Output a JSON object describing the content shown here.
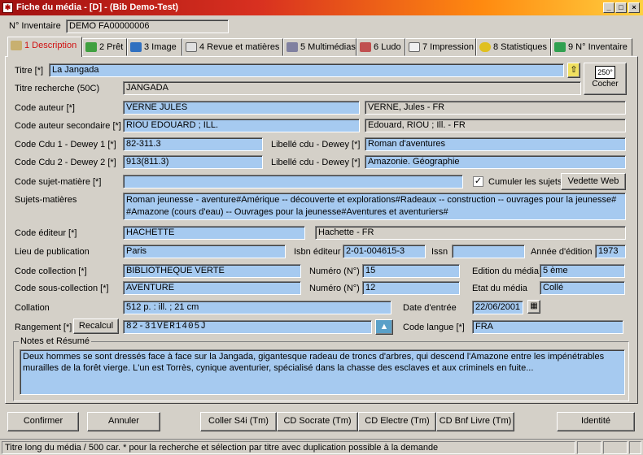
{
  "window": {
    "title": "Fiche du média - [D] - (Bib Demo-Test)"
  },
  "inventory": {
    "label": "N° Inventaire",
    "value": "DEMO FA00000006"
  },
  "tabs": [
    {
      "label": "1 Description"
    },
    {
      "label": "2 Prêt"
    },
    {
      "label": "3 Image"
    },
    {
      "label": "4 Revue et matières"
    },
    {
      "label": "5 Multimédias"
    },
    {
      "label": "6 Ludo"
    },
    {
      "label": "7 Impression"
    },
    {
      "label": "8 Statistiques"
    },
    {
      "label": "9 N° Inventaire"
    }
  ],
  "fields": {
    "titre": {
      "label": "Titre [*]",
      "value": "La Jangada"
    },
    "titre_recherche": {
      "label": "Titre recherche (50C)",
      "value": "JANGADA"
    },
    "code_auteur": {
      "label": "Code auteur [*]",
      "value": "VERNE JULES",
      "libelle": "VERNE, Jules - FR"
    },
    "code_auteur_sec": {
      "label": "Code auteur secondaire [*]",
      "value": "RIOU EDOUARD ; ILL.",
      "libelle": "Edouard, RIOU ; Ill. - FR"
    },
    "cdu1": {
      "label": "Code Cdu 1 - Dewey 1 [*]",
      "value": "82-311.3",
      "lib_label": "Libellé cdu - Dewey [*]",
      "libelle": "Roman d'aventures"
    },
    "cdu2": {
      "label": "Code Cdu 2 - Dewey 2 [*]",
      "value": "913(811.3)",
      "lib_label": "Libellé cdu - Dewey [*]",
      "libelle": "Amazonie. Géographie"
    },
    "sujet_matiere": {
      "label": "Code sujet-matière [*]",
      "value": "",
      "cumuler": "Cumuler les sujets",
      "vedette": "Vedette Web"
    },
    "sujets": {
      "label": "Sujets-matières",
      "value": "Roman jeunesse - aventure#Amérique -- découverte et explorations#Radeaux -- construction -- ouvrages pour la jeunesse# #Amazone (cours d'eau) -- Ouvrages pour la jeunesse#Aventures et aventuriers#"
    },
    "editeur": {
      "label": "Code éditeur [*]",
      "value": "HACHETTE",
      "libelle": "Hachette - FR"
    },
    "lieu": {
      "label": "Lieu de publication",
      "value": "Paris"
    },
    "isbn": {
      "label": "Isbn éditeur",
      "value": "2-01-004615-3"
    },
    "issn": {
      "label": "Issn",
      "value": ""
    },
    "annee": {
      "label": "Année d'édition",
      "value": "1973"
    },
    "collection": {
      "label": "Code collection [*]",
      "value": "BIBLIOTHEQUE VERTE"
    },
    "numero1": {
      "label": "Numéro (N°)",
      "value": "15"
    },
    "edition": {
      "label": "Edition du média",
      "value": "5 ème"
    },
    "sous_collection": {
      "label": "Code sous-collection [*]",
      "value": "AVENTURE"
    },
    "numero2": {
      "label": "Numéro (N°)",
      "value": "12"
    },
    "etat": {
      "label": "Etat du média",
      "value": "Collé"
    },
    "collation": {
      "label": "Collation",
      "value": "512 p. : ill. ; 21 cm"
    },
    "date_entree": {
      "label": "Date d'entrée",
      "value": "22/06/2001"
    },
    "rangement": {
      "label": "Rangement [*]",
      "value": "82-31VER1405J",
      "recalcul": "Recalcul"
    },
    "langue": {
      "label": "Code langue [*]",
      "value": "FRA"
    }
  },
  "notes": {
    "label": "Notes et Résumé",
    "value": "Deux hommes se sont dressés face à face sur la Jangada, gigantesque radeau de troncs d'arbres, qui descend l'Amazone entre les impénétrables murailles de la forêt vierge. L'un est Torrès, cynique aventurier, spécialisé dans la chasse des esclaves et aux criminels en fuite..."
  },
  "cocher": {
    "badge": "250°",
    "label": "Cocher"
  },
  "buttons": {
    "confirmer": "Confirmer",
    "annuler": "Annuler",
    "coller": "Coller S4i (Tm)",
    "socrate": "CD Socrate (Tm)",
    "electre": "CD Electre (Tm)",
    "bnf": "CD Bnf Livre (Tm)",
    "identite": "Identité"
  },
  "status": {
    "text": "Titre long du média / 500 car. * pour la recherche et sélection par titre avec duplication possible à la demande"
  },
  "colors": {
    "field_blue": "#a6caf0",
    "active_tab": "#d01010"
  }
}
